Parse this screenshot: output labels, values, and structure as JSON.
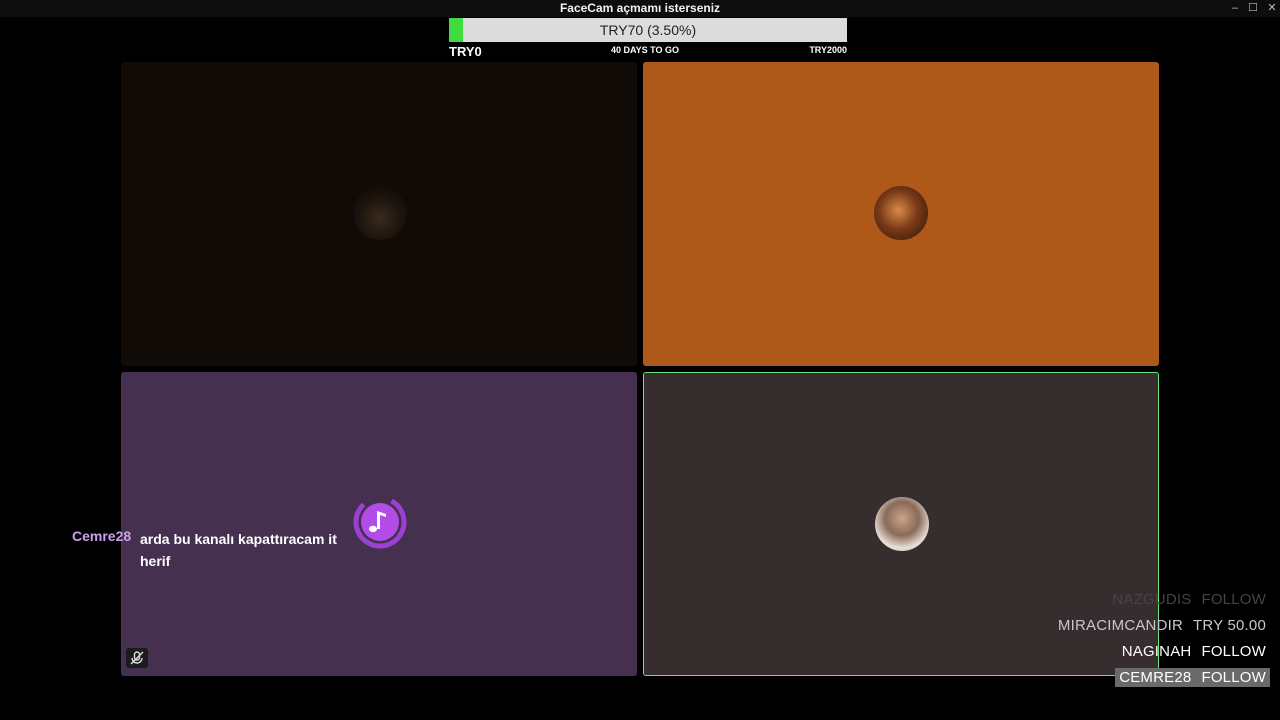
{
  "window": {
    "title": "FaceCam açmamı isterseniz",
    "minimize_icon": "–",
    "maximize_icon": "☐",
    "close_icon": "✕"
  },
  "goal": {
    "progress_text": "TRY70 (3.50%)",
    "progress_fraction": 0.035,
    "min_label": "TRY0",
    "days_label": "40 DAYS TO GO",
    "max_label": "TRY2000",
    "fill_color": "#3fdc3f"
  },
  "tiles": {
    "colors": [
      "#110b08",
      "#ae5919",
      "#45304f",
      "#362e2e"
    ],
    "active_border_color": "#6ee37a"
  },
  "chat": {
    "user": "Cemre28",
    "message": "arda bu kanalı kapattıracam it herif"
  },
  "feed": [
    {
      "name": "NAZGUDIS",
      "action": "FOLLOW"
    },
    {
      "name": "MIRACIMCANDIR",
      "action": "TRY 50.00"
    },
    {
      "name": "NAGINAH",
      "action": "FOLLOW"
    },
    {
      "name": "CEMRE28",
      "action": "FOLLOW"
    }
  ],
  "icons": {
    "music": "music-note-icon",
    "mute": "muted-mic-icon"
  }
}
